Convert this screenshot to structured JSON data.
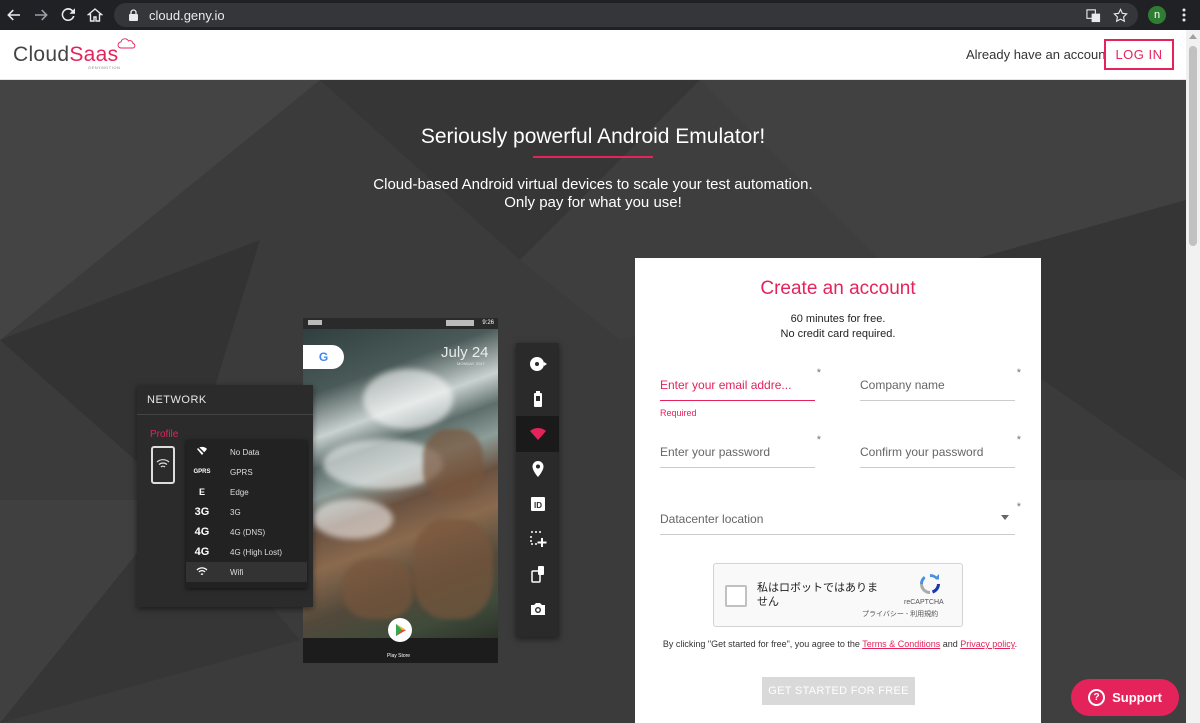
{
  "browser": {
    "url": "cloud.geny.io",
    "profile_initial": "n"
  },
  "header": {
    "logo_cloud": "Cloud",
    "logo_saas": "Saas",
    "logo_sub": "GENYMOTION",
    "already_text": "Already have an account?",
    "login_label": "LOG IN"
  },
  "hero": {
    "title": "Seriously powerful Android Emulator!",
    "subtitle_line1": "Cloud-based Android virtual devices to scale your test automation.",
    "subtitle_line2": "Only pay for what you use!"
  },
  "network_panel": {
    "title": "NETWORK",
    "profile_label": "Profile",
    "items": [
      {
        "code": "",
        "name": "No Data"
      },
      {
        "code": "GPRS",
        "name": "GPRS"
      },
      {
        "code": "E",
        "name": "Edge"
      },
      {
        "code": "3G",
        "name": "3G"
      },
      {
        "code": "4G",
        "name": "4G (DNS)"
      },
      {
        "code": "4G",
        "name": "4G (High Lost)"
      },
      {
        "code": "",
        "name": "Wifi"
      }
    ]
  },
  "phone": {
    "time": "9:26",
    "date": "July 24",
    "date_sub": "MONDAY, 2017",
    "play_label": "Play Store"
  },
  "signup": {
    "title": "Create an account",
    "sub_line1": "60 minutes for free.",
    "sub_line2": "No credit card required.",
    "email_placeholder": "Enter your email addre...",
    "company_placeholder": "Company name",
    "password_placeholder": "Enter your password",
    "confirm_placeholder": "Confirm your password",
    "datacenter_placeholder": "Datacenter location",
    "required_star": "*",
    "required_text": "Required",
    "recaptcha_text": "私はロボットではありません",
    "recaptcha_brand": "reCAPTCHA",
    "recaptcha_links": "プライバシー - 利用規約",
    "terms_prefix": "By clicking \"Get started for free\", you agree to the ",
    "terms_link": "Terms & Conditions",
    "terms_and": " and ",
    "privacy_link": "Privacy policy",
    "terms_suffix": ".",
    "cta_label": "GET STARTED FOR FREE"
  },
  "support": {
    "label": "Support"
  },
  "colors": {
    "accent": "#e5235b",
    "hero_bg": "#3b3b3b"
  }
}
